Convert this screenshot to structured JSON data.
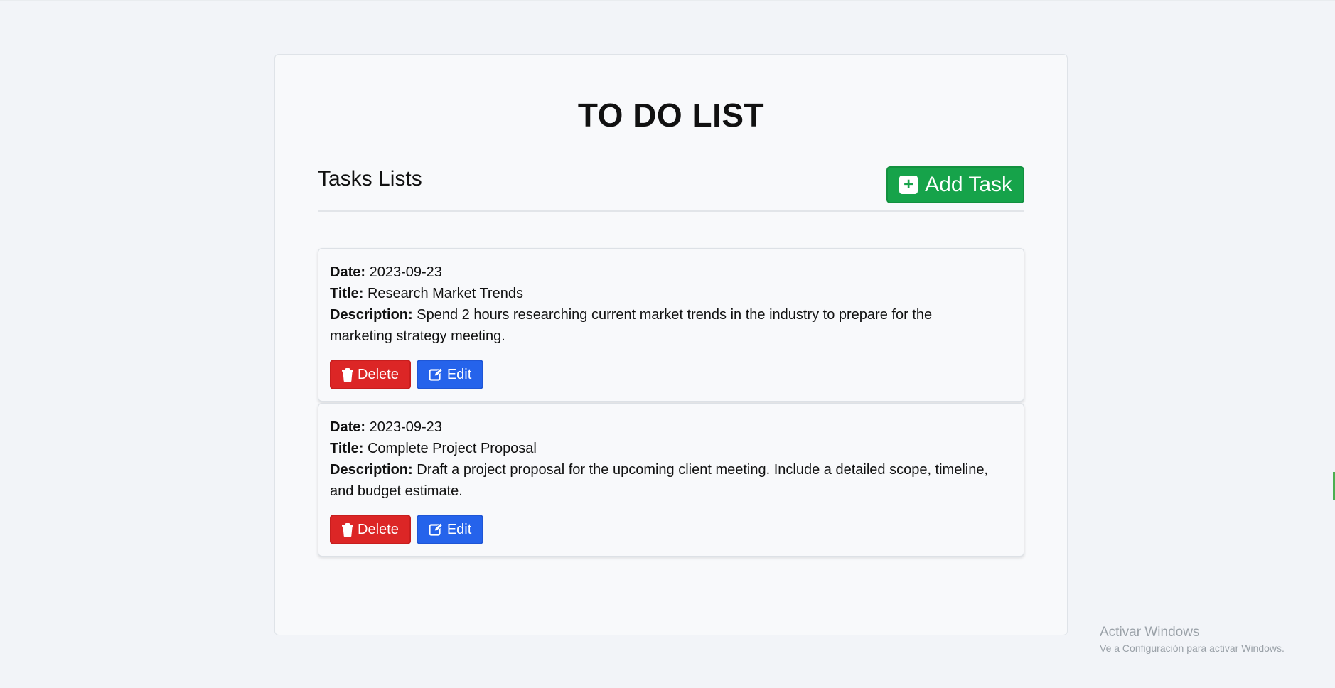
{
  "page": {
    "title": "TO DO LIST",
    "section_heading": "Tasks Lists"
  },
  "toolbar": {
    "add_label": "Add Task",
    "add_icon": "plus-square-icon",
    "accent_color": "#16a34a"
  },
  "labels": {
    "date": "Date:",
    "title": "Title:",
    "description": "Description:"
  },
  "tasks": [
    {
      "date": "2023-09-23",
      "title": "Research Market Trends",
      "description": "Spend 2 hours researching current market trends in the industry to prepare for the marketing strategy meeting.",
      "delete_label": "Delete",
      "edit_label": "Edit"
    },
    {
      "date": "2023-09-23",
      "title": "Complete Project Proposal",
      "description": "Draft a project proposal for the upcoming client meeting. Include a detailed scope, timeline, and budget estimate.",
      "delete_label": "Delete",
      "edit_label": "Edit"
    }
  ],
  "icons": {
    "delete": "trash-icon",
    "edit": "edit-icon"
  },
  "colors": {
    "delete": "#dc2626",
    "edit": "#2563eb"
  },
  "watermark": {
    "title": "Activar Windows",
    "subtitle": "Ve a Configuración para activar Windows."
  }
}
